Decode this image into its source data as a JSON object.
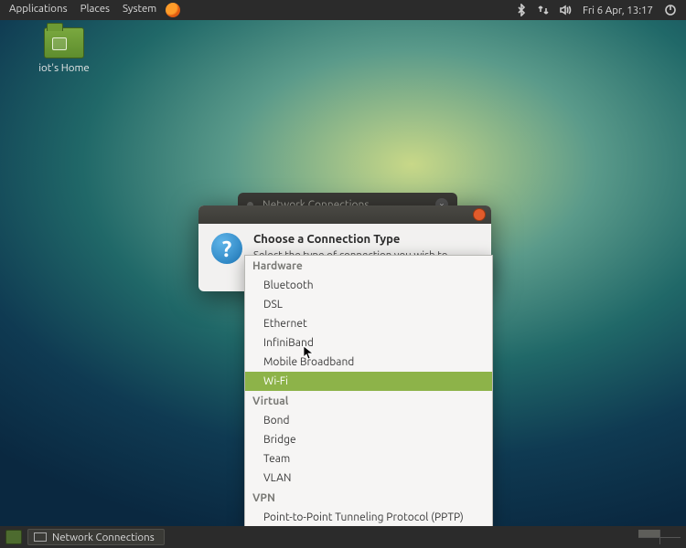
{
  "panel": {
    "menus": [
      "Applications",
      "Places",
      "System"
    ],
    "clock": "Fri 6 Apr, 13:17"
  },
  "desktop": {
    "home_label": "iot's Home"
  },
  "parent_window": {
    "title": "Network Connections"
  },
  "dialog": {
    "heading": "Choose a Connection Type",
    "subtext": "Select the type of connection you wish to create.",
    "groups": [
      {
        "label": "Hardware",
        "items": [
          "Bluetooth",
          "DSL",
          "Ethernet",
          "InfiniBand",
          "Mobile Broadband",
          "Wi-Fi"
        ]
      },
      {
        "label": "Virtual",
        "items": [
          "Bond",
          "Bridge",
          "Team",
          "VLAN"
        ]
      },
      {
        "label": "VPN",
        "items": [
          "Point-to-Point Tunneling Protocol (PPTP)"
        ]
      }
    ],
    "selected": "Wi-Fi"
  },
  "taskbar": {
    "button_label": "Network Connections"
  }
}
